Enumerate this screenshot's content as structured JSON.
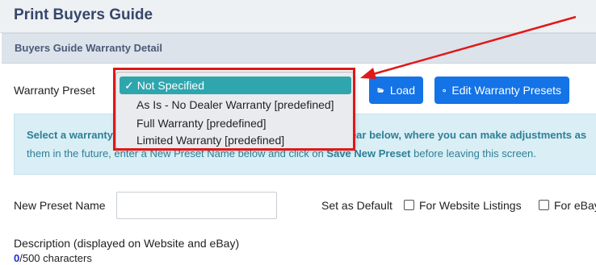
{
  "page": {
    "title": "Print Buyers Guide"
  },
  "section": {
    "title": "Buyers Guide Warranty Detail"
  },
  "warranty_preset": {
    "label": "Warranty Preset",
    "options": [
      "Not Specified",
      "As Is - No Dealer Warranty [predefined]",
      "Full Warranty [predefined]",
      "Limited Warranty [predefined]"
    ],
    "selected_index": 0,
    "check_glyph": "✓"
  },
  "buttons": {
    "load": "Load",
    "edit_presets": "Edit Warranty Presets"
  },
  "info": {
    "line1_start": "Select a warranty",
    "line1_end": "pear below, where you can make adjustments as",
    "line2_start": "them in the future, enter a New Preset Name below and click on",
    "line2_bold": "Save New Preset",
    "line2_end": "before leaving this screen."
  },
  "new_preset": {
    "label": "New Preset Name",
    "value": ""
  },
  "defaults": {
    "label": "Set as Default",
    "website": "For Website Listings",
    "ebay": "For eBay"
  },
  "description": {
    "label": "Description (displayed on Website and eBay)",
    "count": "0",
    "limit_text": "/500 characters"
  },
  "icons": {
    "load": "folder-open-icon",
    "edit": "gear-icon"
  },
  "colors": {
    "primary_button": "#1473e6",
    "selected_option": "#2fa5ae",
    "annotation": "#e01818"
  }
}
